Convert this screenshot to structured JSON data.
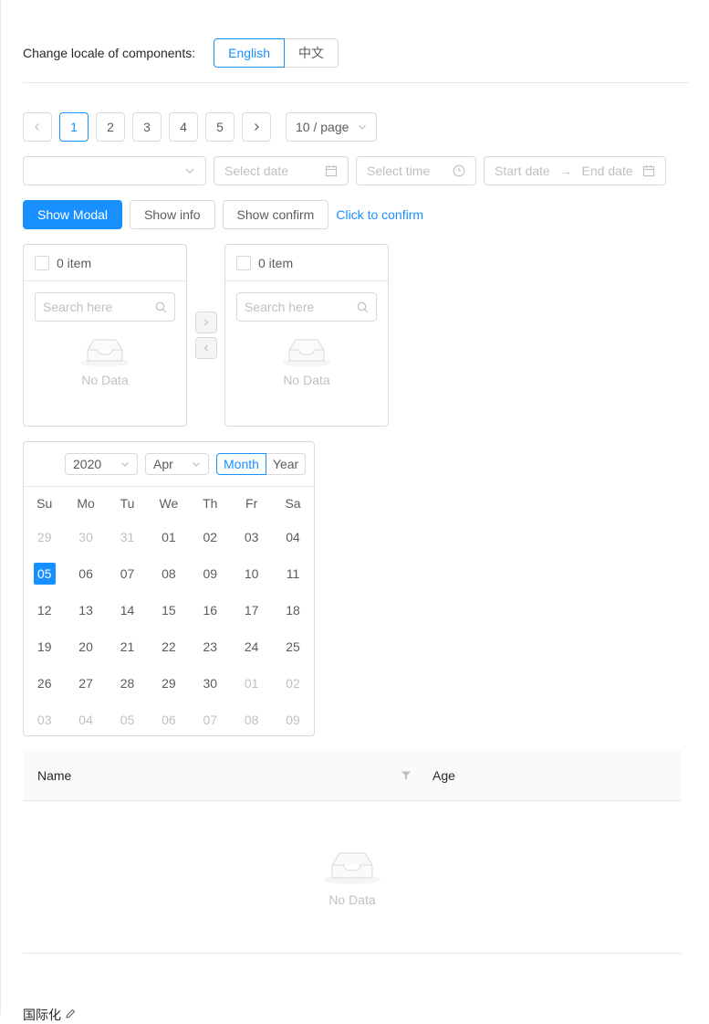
{
  "locale": {
    "label": "Change locale of components:",
    "options": [
      "English",
      "中文"
    ],
    "selected": "English"
  },
  "pagination": {
    "pages": [
      "1",
      "2",
      "3",
      "4",
      "5"
    ],
    "current": "1",
    "page_size": "10 / page"
  },
  "inputs": {
    "select_value": "",
    "date_placeholder": "Select date",
    "time_placeholder": "Select time",
    "range_start": "Start date",
    "range_sep": "→",
    "range_end": "End date"
  },
  "buttons": {
    "show_modal": "Show Modal",
    "show_info": "Show info",
    "show_confirm": "Show confirm",
    "click_confirm": "Click to confirm"
  },
  "transfer": {
    "left": {
      "count": "0 item",
      "search_placeholder": "Search here",
      "empty": "No Data"
    },
    "right": {
      "count": "0 item",
      "search_placeholder": "Search here",
      "empty": "No Data"
    }
  },
  "calendar": {
    "year": "2020",
    "month": "Apr",
    "modes": [
      "Month",
      "Year"
    ],
    "weekdays": [
      "Su",
      "Mo",
      "Tu",
      "We",
      "Th",
      "Fr",
      "Sa"
    ],
    "weeks": [
      [
        "29",
        "30",
        "31",
        "01",
        "02",
        "03",
        "04"
      ],
      [
        "05",
        "06",
        "07",
        "08",
        "09",
        "10",
        "11"
      ],
      [
        "12",
        "13",
        "14",
        "15",
        "16",
        "17",
        "18"
      ],
      [
        "19",
        "20",
        "21",
        "22",
        "23",
        "24",
        "25"
      ],
      [
        "26",
        "27",
        "28",
        "29",
        "30",
        "01",
        "02"
      ],
      [
        "03",
        "04",
        "05",
        "06",
        "07",
        "08",
        "09"
      ]
    ],
    "selected": "05"
  },
  "table": {
    "columns": [
      "Name",
      "Age"
    ],
    "empty": "No Data"
  },
  "footer": {
    "title": "国际化"
  },
  "colors": {
    "primary": "#1890ff",
    "border": "#d9d9d9",
    "muted": "#bfbfbf"
  }
}
